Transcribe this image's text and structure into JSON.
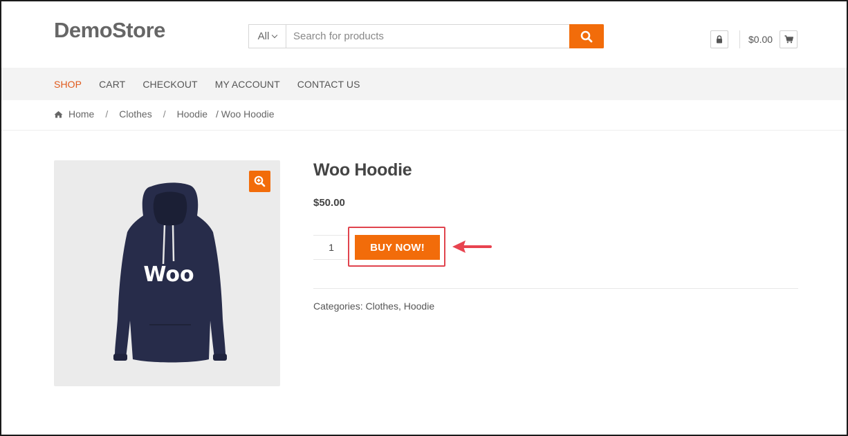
{
  "header": {
    "logo": "DemoStore",
    "search": {
      "category": "All",
      "placeholder": "Search for products",
      "button_icon": "search-icon"
    },
    "account_icon": "lock-icon",
    "cart_total": "$0.00",
    "cart_icon": "cart-icon"
  },
  "nav": {
    "items": [
      {
        "label": "SHOP",
        "active": true
      },
      {
        "label": "CART"
      },
      {
        "label": "CHECKOUT"
      },
      {
        "label": "MY ACCOUNT"
      },
      {
        "label": "CONTACT US"
      }
    ]
  },
  "breadcrumb": {
    "home": "Home",
    "items": [
      "Clothes",
      "Hoodie"
    ],
    "current": "/ Woo Hoodie",
    "separator": "/"
  },
  "product": {
    "title": "Woo Hoodie",
    "price": "$50.00",
    "image_text": "Woo",
    "quantity": "1",
    "buy_label": "BUY NOW!",
    "categories_label": "Categories:",
    "categories": [
      "Clothes",
      "Hoodie"
    ],
    "category_separator": ","
  },
  "colors": {
    "accent": "#f26c0a",
    "nav_active": "#e05a1c",
    "highlight": "#e0434d"
  }
}
